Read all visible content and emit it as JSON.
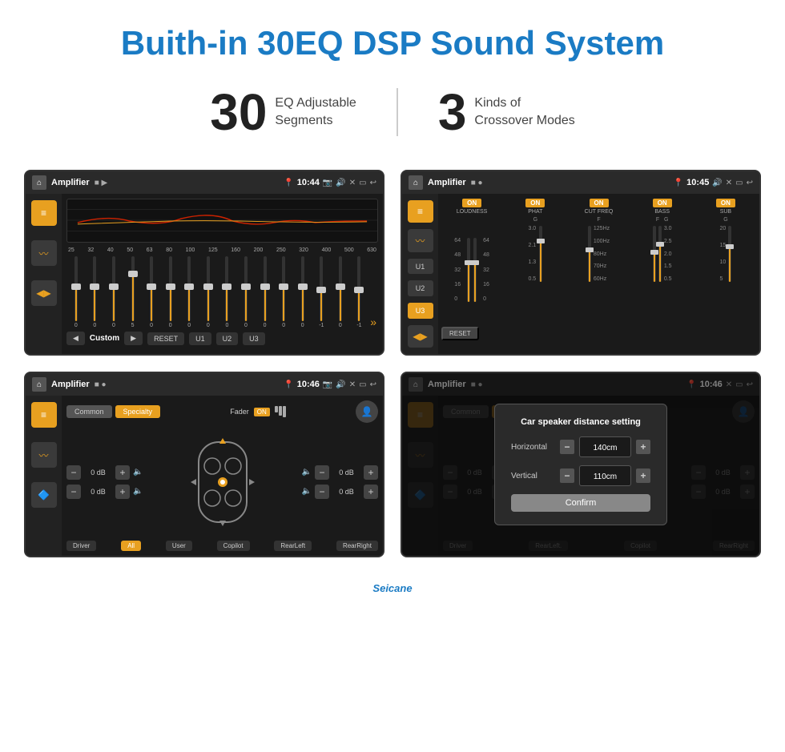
{
  "page": {
    "title": "Buith-in 30EQ DSP Sound System",
    "stats": [
      {
        "number": "30",
        "label": "EQ Adjustable\nSegments"
      },
      {
        "number": "3",
        "label": "Kinds of\nCrossover Modes"
      }
    ]
  },
  "screen1": {
    "topbar": {
      "title": "Amplifier",
      "time": "10:44"
    },
    "eq_labels": [
      "25",
      "32",
      "40",
      "50",
      "63",
      "80",
      "100",
      "125",
      "160",
      "200",
      "250",
      "320",
      "400",
      "500",
      "630"
    ],
    "sliders": [
      0,
      0,
      0,
      5,
      0,
      0,
      0,
      0,
      0,
      0,
      0,
      0,
      0,
      -1,
      0,
      -1
    ],
    "controls": {
      "custom": "Custom",
      "reset": "RESET",
      "u1": "U1",
      "u2": "U2",
      "u3": "U3"
    }
  },
  "screen2": {
    "topbar": {
      "title": "Amplifier",
      "time": "10:45"
    },
    "channels": [
      "LOUDNESS",
      "PHAT",
      "CUT FREQ",
      "BASS",
      "SUB"
    ],
    "u_buttons": [
      "U1",
      "U2",
      "U3"
    ],
    "active_u": "U3",
    "reset_label": "RESET"
  },
  "screen3": {
    "topbar": {
      "title": "Amplifier",
      "time": "10:46"
    },
    "modes": [
      "Common",
      "Specialty"
    ],
    "active_mode": "Specialty",
    "fader_label": "Fader",
    "fader_on": "ON",
    "volumes": [
      {
        "label": "",
        "value": "0 dB"
      },
      {
        "label": "",
        "value": "0 dB"
      },
      {
        "label": "",
        "value": "0 dB"
      },
      {
        "label": "",
        "value": "0 dB"
      }
    ],
    "positions": {
      "driver": "Driver",
      "rear_left": "RearLeft",
      "all": "All",
      "user": "User",
      "copilot": "Copilot",
      "rear_right": "RearRight"
    }
  },
  "screen4": {
    "topbar": {
      "title": "Amplifier",
      "time": "10:46"
    },
    "modes": [
      "Common",
      "Specialty"
    ],
    "active_mode": "Specialty",
    "dialog": {
      "title": "Car speaker distance setting",
      "horizontal_label": "Horizontal",
      "horizontal_value": "140cm",
      "vertical_label": "Vertical",
      "vertical_value": "110cm",
      "confirm_label": "Confirm"
    },
    "positions": {
      "driver": "Driver",
      "rear_left": "RearLeft.",
      "copilot": "Copilot",
      "rear_right": "RearRight"
    }
  },
  "brand": "Seicane"
}
